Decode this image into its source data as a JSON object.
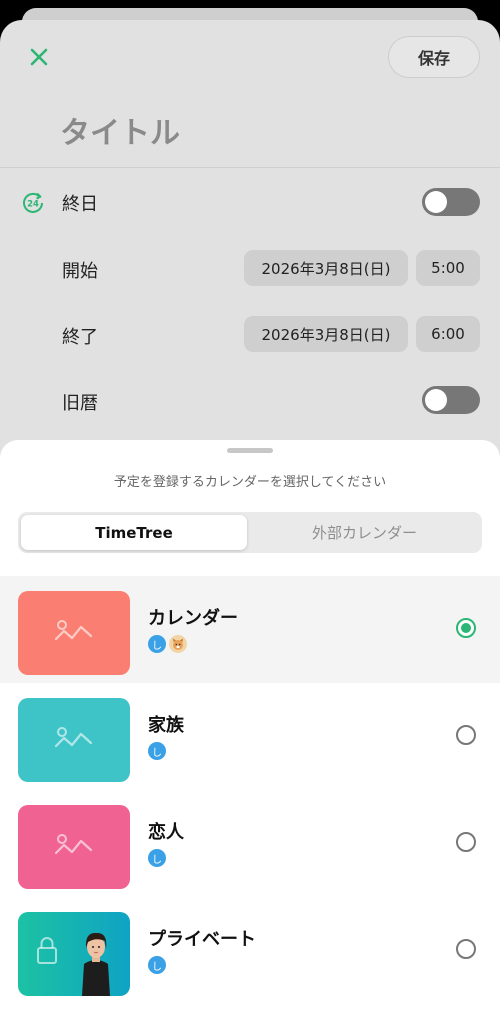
{
  "header": {
    "close_icon": "close-icon",
    "save_label": "保存",
    "title_placeholder": "タイトル"
  },
  "form": {
    "all_day": {
      "label": "終日",
      "icon": "24h-clock-icon",
      "on": false
    },
    "start": {
      "label": "開始",
      "date": "2026年3月8日(日)",
      "time": "5:00"
    },
    "end": {
      "label": "終了",
      "date": "2026年3月8日(日)",
      "time": "6:00"
    },
    "lunar": {
      "label": "旧暦",
      "on": false
    }
  },
  "picker": {
    "prompt": "予定を登録するカレンダーを選択してください",
    "tabs": [
      "TimeTree",
      "外部カレンダー"
    ],
    "active_tab": "TimeTree",
    "calendars": [
      {
        "name": "カレンダー",
        "color": "#fa7f72",
        "selected": true,
        "member_initials": [
          "し"
        ],
        "has_pet_avatar": true
      },
      {
        "name": "家族",
        "color": "#3ec4c7",
        "selected": false,
        "member_initials": [
          "し"
        ]
      },
      {
        "name": "恋人",
        "color": "#f06292",
        "selected": false,
        "member_initials": [
          "し"
        ]
      },
      {
        "name": "プライベート",
        "color": "#19bfa8",
        "selected": false,
        "member_initials": [
          "し"
        ],
        "private": true
      }
    ]
  },
  "colors": {
    "accent": "#2bb673",
    "member_blue": "#3aa1e6"
  }
}
